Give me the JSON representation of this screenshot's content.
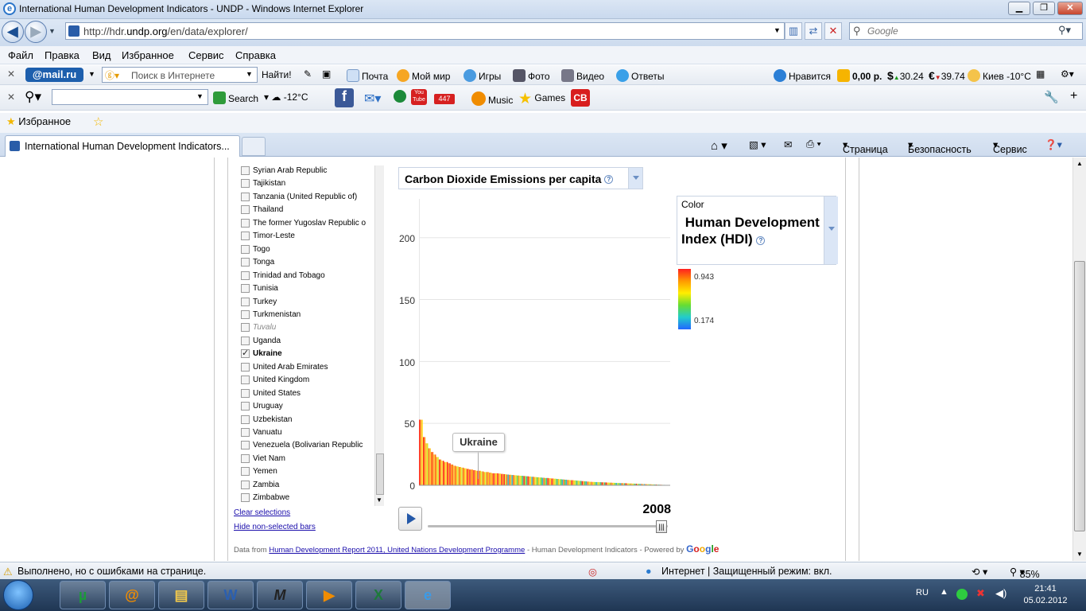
{
  "window": {
    "title": "International Human Development Indicators - UNDP - Windows Internet Explorer"
  },
  "address": {
    "url_prefix": "http://hdr.",
    "url_domain": "undp.org",
    "url_suffix": "/en/data/explorer/"
  },
  "search_box": {
    "placeholder": "Google"
  },
  "menu": [
    "Файл",
    "Правка",
    "Вид",
    "Избранное",
    "Сервис",
    "Справка"
  ],
  "mail_toolbar": {
    "logo": "@mail.ru",
    "search_placeholder": "Поиск в Интернете",
    "find_button": "Найти!",
    "links": [
      "Почта",
      "Мой мир",
      "Игры",
      "Фото",
      "Видео",
      "Ответы"
    ],
    "like": "Нравится",
    "balance": "0,00 р.",
    "usd": "30.24",
    "eur": "39.74",
    "weather": "Киев -10°C"
  },
  "search_toolbar": {
    "search_label": "Search",
    "temp": "-12°C",
    "badge": "447",
    "music": "Music",
    "games": "Games",
    "cb": "CB"
  },
  "favorites_bar": {
    "label": "Избранное"
  },
  "tab": {
    "title": "International Human Development Indicators..."
  },
  "command_bar": {
    "page": "Страница",
    "security": "Безопасность",
    "service": "Сервис"
  },
  "countries": [
    {
      "name": "Syrian Arab Republic",
      "state": "normal"
    },
    {
      "name": "Tajikistan",
      "state": "normal"
    },
    {
      "name": "Tanzania (United Republic of)",
      "state": "normal"
    },
    {
      "name": "Thailand",
      "state": "normal"
    },
    {
      "name": "The former Yugoslav Republic o",
      "state": "normal"
    },
    {
      "name": "Timor-Leste",
      "state": "normal"
    },
    {
      "name": "Togo",
      "state": "normal"
    },
    {
      "name": "Tonga",
      "state": "normal"
    },
    {
      "name": "Trinidad and Tobago",
      "state": "normal"
    },
    {
      "name": "Tunisia",
      "state": "normal"
    },
    {
      "name": "Turkey",
      "state": "normal"
    },
    {
      "name": "Turkmenistan",
      "state": "normal"
    },
    {
      "name": "Tuvalu",
      "state": "disabled"
    },
    {
      "name": "Uganda",
      "state": "normal"
    },
    {
      "name": "Ukraine",
      "state": "checked"
    },
    {
      "name": "United Arab Emirates",
      "state": "normal"
    },
    {
      "name": "United Kingdom",
      "state": "normal"
    },
    {
      "name": "United States",
      "state": "normal"
    },
    {
      "name": "Uruguay",
      "state": "normal"
    },
    {
      "name": "Uzbekistan",
      "state": "normal"
    },
    {
      "name": "Vanuatu",
      "state": "normal"
    },
    {
      "name": "Venezuela (Bolivarian Republic",
      "state": "normal"
    },
    {
      "name": "Viet Nam",
      "state": "normal"
    },
    {
      "name": "Yemen",
      "state": "normal"
    },
    {
      "name": "Zambia",
      "state": "normal"
    },
    {
      "name": "Zimbabwe",
      "state": "normal"
    }
  ],
  "list_links": {
    "clear": "Clear selections",
    "hide": "Hide non-selected bars"
  },
  "indicator": {
    "label": "Carbon Dioxide Emissions per capita"
  },
  "color_selector": {
    "label": "Color",
    "value": "Human Development Index (HDI)"
  },
  "legend": {
    "max": "0.943",
    "min": "0.174"
  },
  "tooltip": "Ukraine",
  "year": "2008",
  "footer": {
    "prefix": "Data from",
    "link": "Human Development Report 2011, United Nations Development Programme",
    "suffix": "- Human Development Indicators - Powered by",
    "brand": "Google"
  },
  "status": {
    "message": "Выполнено, но с ошибками на странице.",
    "zone": "Интернет | Защищенный режим: вкл.",
    "zoom": "85%"
  },
  "tray": {
    "lang": "RU",
    "time": "21:41",
    "date": "05.02.2012"
  },
  "chart_data": {
    "type": "bar",
    "ylim": [
      0,
      230
    ],
    "yticks": [
      0,
      50,
      100,
      150,
      200
    ],
    "bar_count": 190,
    "values_desc": [
      53,
      39,
      34,
      30,
      27,
      25,
      23,
      21,
      20,
      19,
      18,
      17,
      16,
      15.5,
      15,
      14.5,
      14,
      13.5,
      13,
      12.5,
      12,
      12,
      11.5,
      11,
      11,
      10.5,
      10,
      10,
      9.8,
      9.5,
      9.3,
      9,
      8.8,
      8.6,
      8.4,
      8.2,
      8,
      7.8,
      7.6,
      7.4,
      7.2,
      7,
      6.8,
      6.6,
      6.4,
      6.2,
      6,
      5.8,
      5.6,
      5.4,
      5.2,
      5,
      4.8,
      4.6,
      4.4,
      4.2,
      4,
      3.8,
      3.6,
      3.4,
      3.2,
      3,
      2.9,
      2.8,
      2.7,
      2.6,
      2.5,
      2.4,
      2.3,
      2.2,
      2.1,
      2,
      1.9,
      1.8,
      1.7,
      1.6,
      1.5,
      1.4,
      1.3,
      1.2,
      1.1,
      1,
      0.9,
      0.8,
      0.7,
      0.6,
      0.5,
      0.4,
      0.3,
      0.2
    ],
    "highlight": {
      "name": "Ukraine",
      "value": 7
    }
  }
}
